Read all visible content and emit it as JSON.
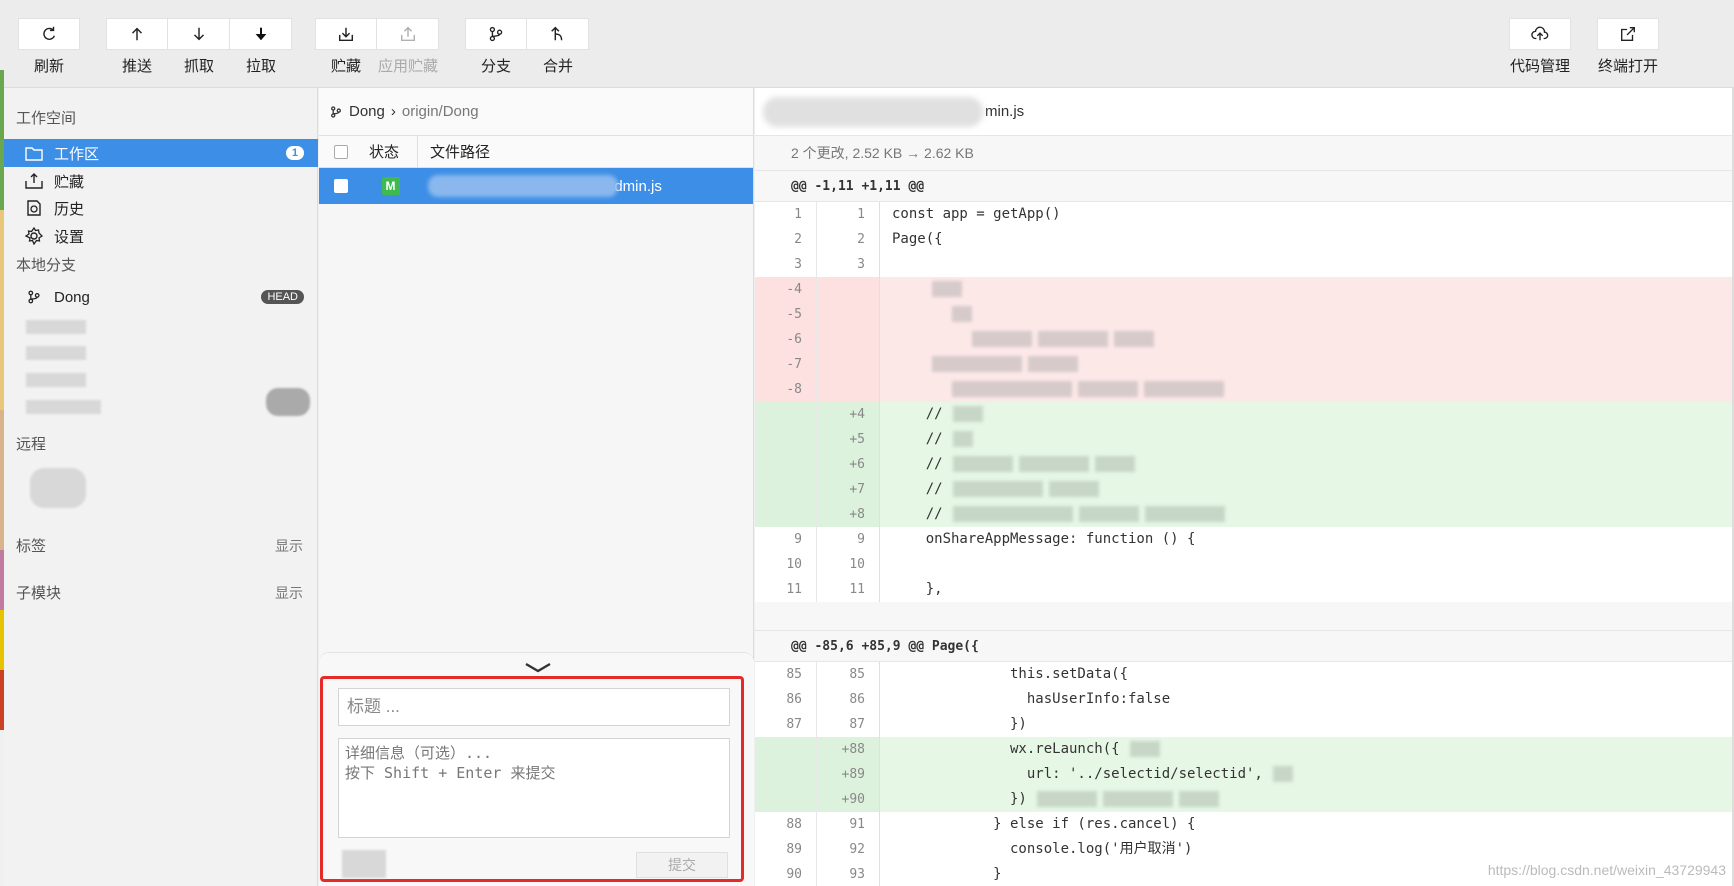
{
  "toolbar": {
    "refresh": "刷新",
    "push": "推送",
    "fetch": "抓取",
    "pull": "拉取",
    "stash": "贮藏",
    "apply_stash": "应用贮藏",
    "branch": "分支",
    "merge": "合并",
    "code_management": "代码管理",
    "open_terminal": "终端打开"
  },
  "sidebar": {
    "workspace_title": "工作空间",
    "items": [
      {
        "label": "工作区",
        "badge": "1"
      },
      {
        "label": "贮藏"
      },
      {
        "label": "历史"
      },
      {
        "label": "设置"
      }
    ],
    "local_branches_title": "本地分支",
    "branch": {
      "name": "Dong",
      "tag": "HEAD"
    },
    "remote_title": "远程",
    "tags_title": "标签",
    "tags_toggle": "显示",
    "submodules_title": "子模块",
    "submodules_toggle": "显示"
  },
  "files": {
    "branch": "Dong",
    "remote": "origin/Dong",
    "col_status": "状态",
    "col_path": "文件路径",
    "row": {
      "status": "M",
      "path_visible": "admin.js"
    }
  },
  "commit": {
    "title_placeholder": "标题 ...",
    "detail_placeholder": "详细信息（可选）...\n按下 Shift + Enter 来提交",
    "submit": "提交"
  },
  "diff": {
    "file_visible": "min.js",
    "stat": "2 个更改, 2.52 KB → 2.62 KB",
    "hunk1": "@@ -1,11 +1,11 @@",
    "hunk2": "@@ -85,6 +85,9 @@ Page({",
    "lines1": [
      {
        "t": "ctx",
        "o": "1",
        "n": "1",
        "c": "const app = getApp()"
      },
      {
        "t": "ctx",
        "o": "2",
        "n": "2",
        "c": "Page({"
      },
      {
        "t": "ctx",
        "o": "3",
        "n": "3",
        "c": ""
      },
      {
        "t": "del",
        "o": "-4",
        "n": "",
        "c": ""
      },
      {
        "t": "del",
        "o": "-5",
        "n": "",
        "c": ""
      },
      {
        "t": "del",
        "o": "-6",
        "n": "",
        "c": ""
      },
      {
        "t": "del",
        "o": "-7",
        "n": "",
        "c": ""
      },
      {
        "t": "del",
        "o": "-8",
        "n": "",
        "c": ""
      },
      {
        "t": "add",
        "o": "",
        "n": "+4",
        "c": "    //"
      },
      {
        "t": "add",
        "o": "",
        "n": "+5",
        "c": "    //"
      },
      {
        "t": "add",
        "o": "",
        "n": "+6",
        "c": "    //"
      },
      {
        "t": "add",
        "o": "",
        "n": "+7",
        "c": "    //"
      },
      {
        "t": "add",
        "o": "",
        "n": "+8",
        "c": "    //"
      },
      {
        "t": "ctx",
        "o": "9",
        "n": "9",
        "c": "    onShareAppMessage: function () {"
      },
      {
        "t": "ctx",
        "o": "10",
        "n": "10",
        "c": ""
      },
      {
        "t": "ctx",
        "o": "11",
        "n": "11",
        "c": "    },"
      }
    ],
    "lines2": [
      {
        "t": "ctx",
        "o": "85",
        "n": "85",
        "c": "              this.setData({"
      },
      {
        "t": "ctx",
        "o": "86",
        "n": "86",
        "c": "                hasUserInfo:false"
      },
      {
        "t": "ctx",
        "o": "87",
        "n": "87",
        "c": "              })"
      },
      {
        "t": "add",
        "o": "",
        "n": "+88",
        "c": "              wx.reLaunch({"
      },
      {
        "t": "add",
        "o": "",
        "n": "+89",
        "c": "                url: '../selectid/selectid',"
      },
      {
        "t": "add",
        "o": "",
        "n": "+90",
        "c": "              })"
      },
      {
        "t": "ctx",
        "o": "88",
        "n": "91",
        "c": "            } else if (res.cancel) {"
      },
      {
        "t": "ctx",
        "o": "89",
        "n": "92",
        "c": "              console.log('用户取消')"
      },
      {
        "t": "ctx",
        "o": "90",
        "n": "93",
        "c": "            }"
      }
    ]
  },
  "watermark": "https://blog.csdn.net/weixin_43729943",
  "colors": {
    "accent": "#3d8ee6",
    "highlight_border": "#e62a2a",
    "added_bg": "#e6f7e6",
    "removed_bg": "#fde8e8"
  }
}
